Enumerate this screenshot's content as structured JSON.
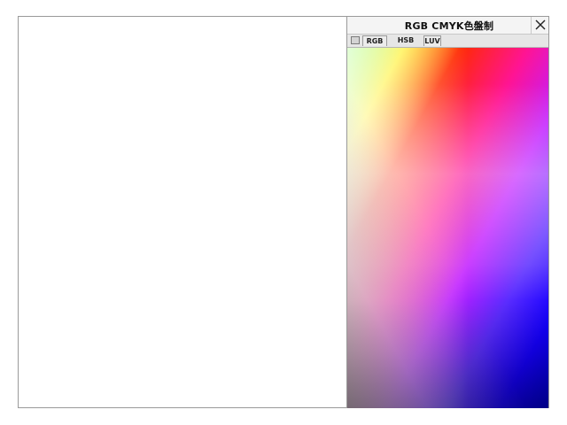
{
  "panel": {
    "title": "RGB  CMYK色盤制",
    "tabs": [
      {
        "label": "RGB"
      },
      {
        "label": "HSB"
      },
      {
        "label": "LUV"
      }
    ]
  },
  "icons": {
    "close": "close-icon",
    "checkbox": "checkbox-icon"
  },
  "colors": {
    "border": "#9a9a9a",
    "titlebar": "#f4f4f4",
    "tabbar": "#e6e6e6"
  }
}
